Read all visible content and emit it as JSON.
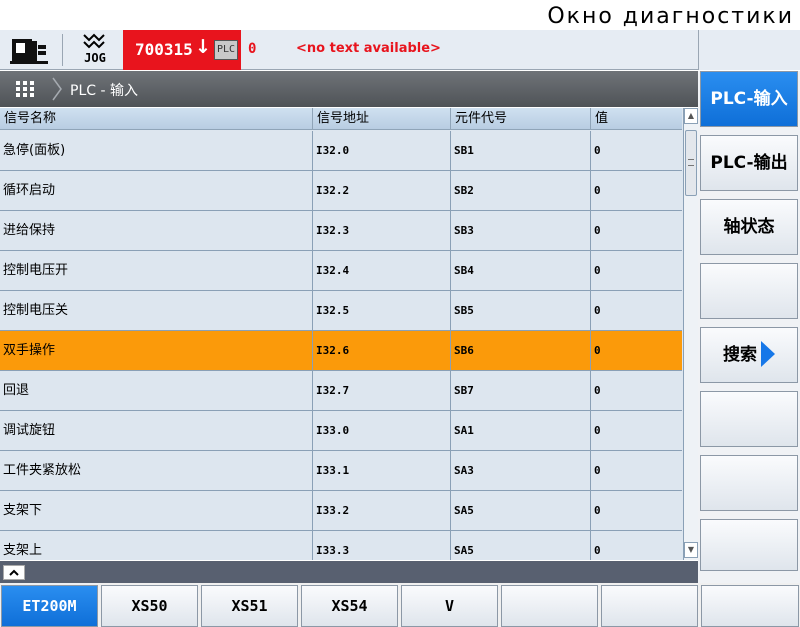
{
  "window": {
    "caption": "Окно диагностики"
  },
  "status": {
    "mode": "JOG",
    "alarm_number": "700315",
    "alarm_arrow": "↓",
    "alarm_source": "PLC",
    "alarm_count": "0",
    "alarm_text": "<no text available>",
    "alarm_color": "#e8141d"
  },
  "breadcrumb": {
    "text": "PLC - 输入"
  },
  "table": {
    "columns": [
      "信号名称",
      "信号地址",
      "元件代号",
      "值"
    ],
    "rows": [
      [
        "急停(面板)",
        "I32.0",
        "SB1",
        "0"
      ],
      [
        "循环启动",
        "I32.2",
        "SB2",
        "0"
      ],
      [
        "进给保持",
        "I32.3",
        "SB3",
        "0"
      ],
      [
        "控制电压开",
        "I32.4",
        "SB4",
        "0"
      ],
      [
        "控制电压关",
        "I32.5",
        "SB5",
        "0"
      ],
      [
        "双手操作",
        "I32.6",
        "SB6",
        "0"
      ],
      [
        "回退",
        "I32.7",
        "SB7",
        "0"
      ],
      [
        "调试旋钮",
        "I33.0",
        "SA1",
        "0"
      ],
      [
        "工件夹紧放松",
        "I33.1",
        "SA3",
        "0"
      ],
      [
        "支架下",
        "I33.2",
        "SA5",
        "0"
      ],
      [
        "支架上",
        "I33.3",
        "SA5",
        "0"
      ]
    ],
    "selected_row": 5,
    "selection_color": "#fb9a0a"
  },
  "vertical_softkeys": [
    "PLC-输入",
    "PLC-输出",
    "轴状态",
    "",
    "搜索",
    "",
    "",
    ""
  ],
  "horizontal_softkeys": [
    "ET200M",
    "XS50",
    "XS51",
    "XS54",
    "V",
    "",
    "",
    ""
  ],
  "accent_color": "#1677e8",
  "icons": {
    "machine": "machine-tool-icon",
    "jog": "jog-wave-icon",
    "menu": "menu-grid-icon",
    "search_arrow": "arrow-right-icon",
    "recall": "chevron-up-icon"
  }
}
